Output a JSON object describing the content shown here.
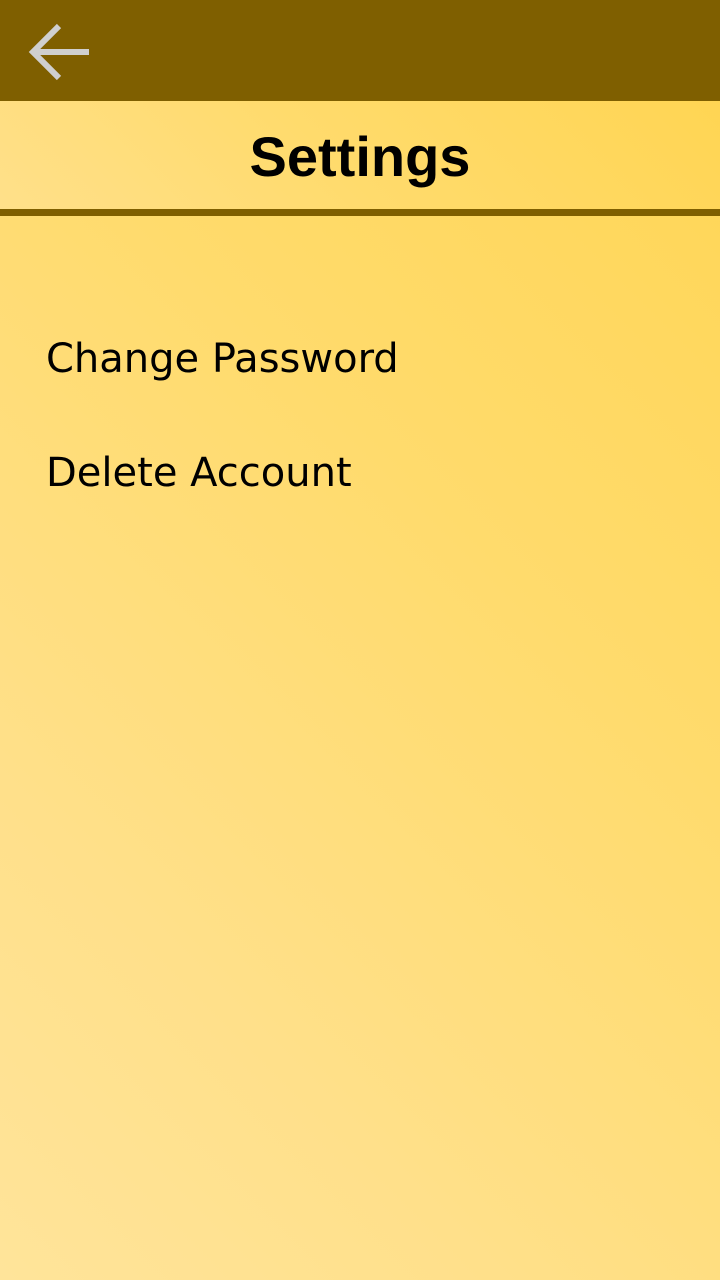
{
  "app": {
    "icons": {
      "back": "arrow-left-icon"
    },
    "colors": {
      "top_bar": "#7f5f00",
      "back_icon": "#cfcfcf",
      "background_light": "#ffe49a",
      "background_dark": "#ffd553",
      "text": "#000000"
    }
  },
  "header": {
    "title": "Settings"
  },
  "menu": {
    "items": [
      {
        "label": "Change Password"
      },
      {
        "label": "Delete Account"
      }
    ]
  }
}
